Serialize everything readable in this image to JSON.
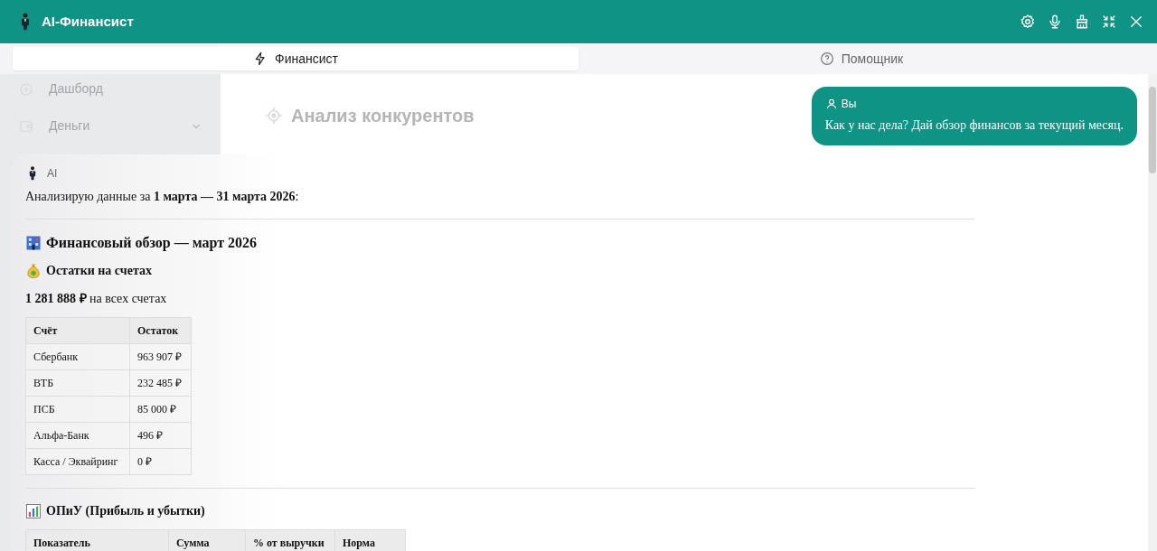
{
  "app": {
    "title": "AI-Финансист"
  },
  "sidebar": {
    "items": [
      {
        "label": "Дашборд",
        "expandable": false
      },
      {
        "label": "Деньги",
        "expandable": true
      }
    ]
  },
  "page": {
    "title": "Анализ конкурентов"
  },
  "tabs": [
    {
      "label": "Финансист",
      "selected": true
    },
    {
      "label": "Помощник",
      "selected": false
    }
  ],
  "messages": [
    {
      "kind": "outgoing",
      "author": "Вы",
      "text": "Как у нас дела? Дай обзор финансов за текущий месяц."
    },
    {
      "kind": "incoming",
      "author": "AI",
      "blocks": [
        {
          "kind": "paragraph",
          "text": "Анализирую данные за **1 марта — 31 марта 2026**:"
        },
        {
          "kind": "rule"
        },
        {
          "kind": "title",
          "text": "Финансовый обзор — март 2026"
        },
        {
          "kind": "heading",
          "text": "Остатки на счетах"
        },
        {
          "kind": "paragraph",
          "text": "**1 281 888 ₽** на всех счетах"
        },
        {
          "kind": "table",
          "columns": [
            "Счёт",
            "Остаток"
          ],
          "rows": [
            [
              "Сбербанк",
              "963 907 ₽"
            ],
            [
              "ВТБ",
              "232 485 ₽"
            ],
            [
              "ПСБ",
              "85 000 ₽"
            ],
            [
              "Альфа-Банк",
              "496 ₽"
            ],
            [
              "Касса / Эквайринг",
              "0 ₽"
            ]
          ]
        },
        {
          "kind": "rule"
        },
        {
          "kind": "heading",
          "text": "ОПиУ (Прибыль и убытки)"
        },
        {
          "kind": "table",
          "columns": [
            "Показатель",
            "Сумма",
            "% от выручки",
            "Норма"
          ]
        }
      ]
    }
  ]
}
